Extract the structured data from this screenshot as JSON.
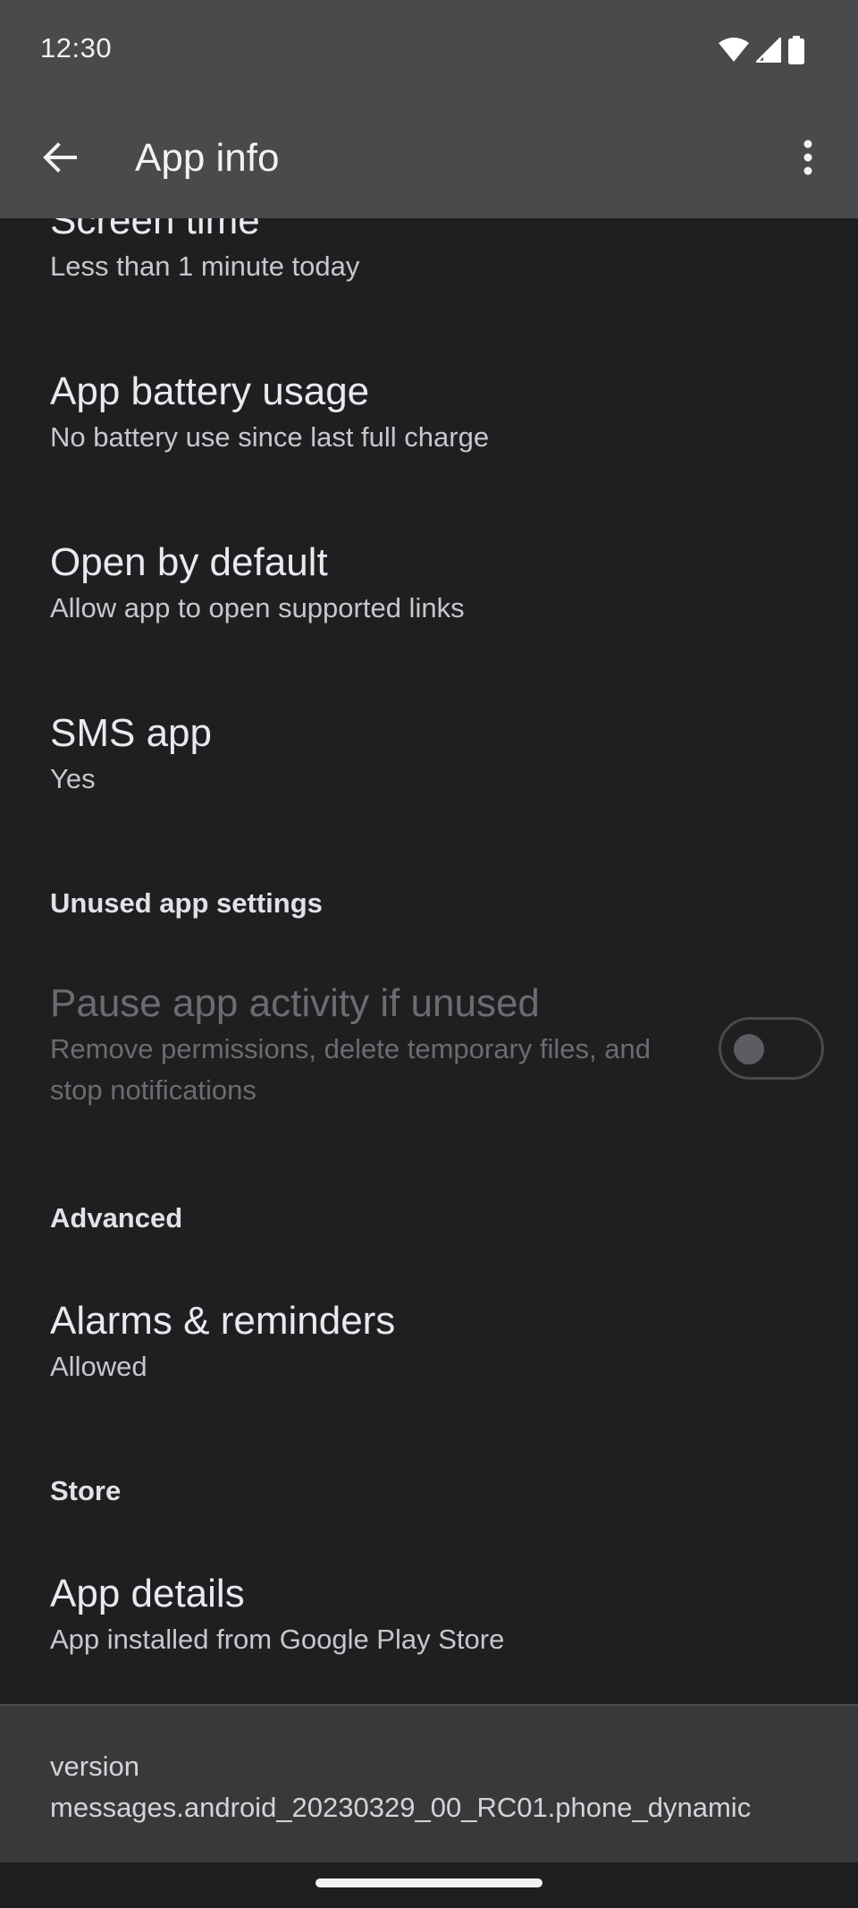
{
  "status_bar": {
    "time": "12:30",
    "icons": [
      "wifi-icon",
      "cell-signal-icon",
      "battery-icon"
    ]
  },
  "app_bar": {
    "title": "App info",
    "back_icon": "arrow-back-icon",
    "more_icon": "more-vert-icon"
  },
  "items": {
    "screen_time": {
      "title": "Screen time",
      "subtitle": "Less than 1 minute today"
    },
    "battery": {
      "title": "App battery usage",
      "subtitle": "No battery use since last full charge"
    },
    "open_default": {
      "title": "Open by default",
      "subtitle": "Allow app to open supported links"
    },
    "sms_app": {
      "title": "SMS app",
      "subtitle": "Yes"
    },
    "pause_activity": {
      "title": "Pause app activity if unused",
      "subtitle": "Remove permissions, delete temporary files, and stop notifications",
      "enabled": false,
      "toggle_on": false
    },
    "alarms": {
      "title": "Alarms & reminders",
      "subtitle": "Allowed"
    },
    "app_details": {
      "title": "App details",
      "subtitle": "App installed from Google Play Store"
    }
  },
  "sections": {
    "unused": "Unused app settings",
    "advanced": "Advanced",
    "store": "Store"
  },
  "version": {
    "label": "version",
    "value": "messages.android_20230329_00_RC01.phone_dynamic"
  },
  "colors": {
    "background": "#1f1f21",
    "app_bar": "#4a4a4c",
    "version_panel": "#39393b"
  }
}
